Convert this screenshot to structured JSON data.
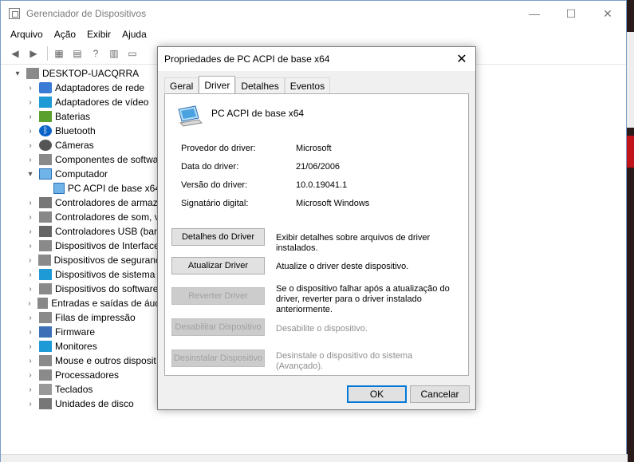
{
  "window": {
    "title": "Gerenciador de Dispositivos",
    "controls": {
      "minimize": "—",
      "maximize": "☐",
      "close": "✕"
    }
  },
  "menu": [
    "Arquivo",
    "Ação",
    "Exibir",
    "Ajuda"
  ],
  "tree": {
    "root": "DESKTOP-UACQRRA",
    "items": [
      {
        "label": "Adaptadores de rede",
        "icon": "network-adapter-icon"
      },
      {
        "label": "Adaptadores de vídeo",
        "icon": "display-adapter-icon"
      },
      {
        "label": "Baterias",
        "icon": "battery-icon"
      },
      {
        "label": "Bluetooth",
        "icon": "bluetooth-icon"
      },
      {
        "label": "Câmeras",
        "icon": "camera-icon"
      },
      {
        "label": "Componentes de softwa",
        "icon": "software-component-icon"
      },
      {
        "label": "Computador",
        "icon": "computer-icon",
        "expanded": true
      },
      {
        "label": "PC ACPI de base x64",
        "icon": "computer-icon",
        "child": true
      },
      {
        "label": "Controladores de armaz",
        "icon": "storage-controller-icon"
      },
      {
        "label": "Controladores de som, v",
        "icon": "sound-icon"
      },
      {
        "label": "Controladores USB (barr",
        "icon": "usb-icon"
      },
      {
        "label": "Dispositivos de Interface",
        "icon": "hid-icon"
      },
      {
        "label": "Dispositivos de seguranç",
        "icon": "security-device-icon"
      },
      {
        "label": "Dispositivos de sistema",
        "icon": "system-device-icon"
      },
      {
        "label": "Dispositivos do software",
        "icon": "software-device-icon"
      },
      {
        "label": "Entradas e saídas de áud",
        "icon": "audio-io-icon"
      },
      {
        "label": "Filas de impressão",
        "icon": "print-queue-icon"
      },
      {
        "label": "Firmware",
        "icon": "firmware-icon"
      },
      {
        "label": "Monitores",
        "icon": "monitor-icon"
      },
      {
        "label": "Mouse e outros disposit",
        "icon": "mouse-icon"
      },
      {
        "label": "Processadores",
        "icon": "processor-icon"
      },
      {
        "label": "Teclados",
        "icon": "keyboard-icon"
      },
      {
        "label": "Unidades de disco",
        "icon": "disk-drive-icon"
      }
    ]
  },
  "dialog": {
    "title": "Propriedades de PC ACPI de base x64",
    "close": "✕",
    "tabs": [
      "Geral",
      "Driver",
      "Detalhes",
      "Eventos"
    ],
    "active_tab": "Driver",
    "device_name": "PC ACPI de base x64",
    "properties": [
      {
        "label": "Provedor do driver:",
        "value": "Microsoft"
      },
      {
        "label": "Data do driver:",
        "value": "21/06/2006"
      },
      {
        "label": "Versão do driver:",
        "value": "10.0.19041.1"
      },
      {
        "label": "Signatário digital:",
        "value": "Microsoft Windows"
      }
    ],
    "buttons": [
      {
        "label": "Detalhes do Driver",
        "desc": "Exibir detalhes sobre arquivos de driver instalados.",
        "enabled": true
      },
      {
        "label": "Atualizar Driver",
        "desc": "Atualize o driver deste dispositivo.",
        "enabled": true
      },
      {
        "label": "Reverter Driver",
        "desc": "Se o dispositivo falhar após a atualização do driver, reverter para o driver instalado anteriormente.",
        "enabled": false
      },
      {
        "label": "Desabilitar Dispositivo",
        "desc": "Desabilite o dispositivo.",
        "enabled": false
      },
      {
        "label": "Desinstalar Dispositivo",
        "desc": "Desinstale o dispositivo do sistema (Avançado).",
        "enabled": false
      }
    ],
    "ok": "OK",
    "cancel": "Cancelar"
  }
}
